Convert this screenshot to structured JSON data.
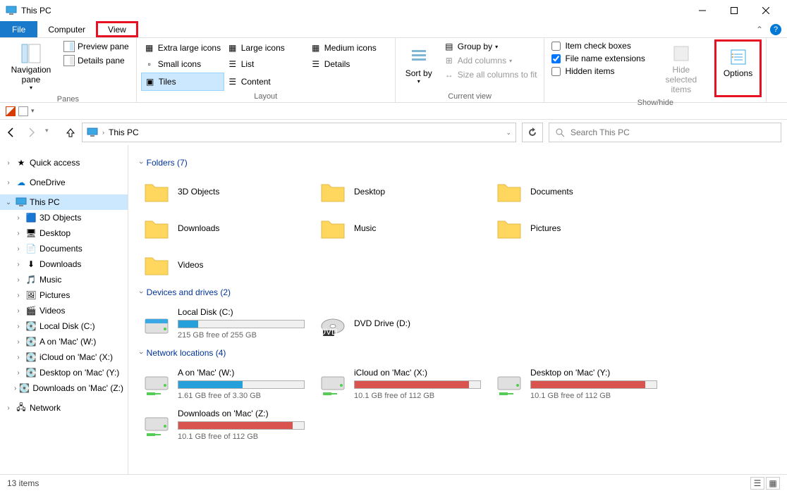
{
  "window": {
    "title": "This PC"
  },
  "tabs": {
    "file": "File",
    "computer": "Computer",
    "view": "View"
  },
  "ribbon": {
    "panes": {
      "navigation": "Navigation pane",
      "preview": "Preview pane",
      "details": "Details pane",
      "group": "Panes"
    },
    "layout": {
      "xl": "Extra large icons",
      "lg": "Large icons",
      "md": "Medium icons",
      "sm": "Small icons",
      "list": "List",
      "det": "Details",
      "tiles": "Tiles",
      "content": "Content",
      "group": "Layout"
    },
    "current": {
      "sort": "Sort by",
      "groupby": "Group by",
      "addcols": "Add columns",
      "sizecols": "Size all columns to fit",
      "group": "Current view"
    },
    "showhide": {
      "itemchk": "Item check boxes",
      "ext": "File name extensions",
      "hidden": "Hidden items",
      "hidesel": "Hide selected items",
      "options": "Options",
      "group": "Show/hide",
      "ext_checked": true,
      "itemchk_checked": false,
      "hidden_checked": false
    }
  },
  "addressbar": {
    "location": "This PC"
  },
  "search": {
    "placeholder": "Search This PC"
  },
  "sidebar": {
    "quick": "Quick access",
    "onedrive": "OneDrive",
    "thispc": "This PC",
    "children": [
      "3D Objects",
      "Desktop",
      "Documents",
      "Downloads",
      "Music",
      "Pictures",
      "Videos",
      "Local Disk (C:)",
      "A on 'Mac' (W:)",
      "iCloud on 'Mac' (X:)",
      "Desktop on 'Mac' (Y:)",
      "Downloads on 'Mac' (Z:)"
    ],
    "network": "Network"
  },
  "sections": {
    "folders": {
      "title": "Folders (7)",
      "items": [
        "3D Objects",
        "Desktop",
        "Documents",
        "Downloads",
        "Music",
        "Pictures",
        "Videos"
      ]
    },
    "drives": {
      "title": "Devices and drives (2)",
      "items": [
        {
          "name": "Local Disk (C:)",
          "sub": "215 GB free of 255 GB",
          "fill": 16,
          "color": "blue",
          "type": "hdd"
        },
        {
          "name": "DVD Drive (D:)",
          "sub": "",
          "fill": 0,
          "color": "",
          "type": "dvd"
        }
      ]
    },
    "network": {
      "title": "Network locations (4)",
      "items": [
        {
          "name": "A on 'Mac' (W:)",
          "sub": "1.61 GB free of 3.30 GB",
          "fill": 51,
          "color": "blue"
        },
        {
          "name": "iCloud on 'Mac' (X:)",
          "sub": "10.1 GB free of 112 GB",
          "fill": 91,
          "color": "red"
        },
        {
          "name": "Desktop on 'Mac' (Y:)",
          "sub": "10.1 GB free of 112 GB",
          "fill": 91,
          "color": "red"
        },
        {
          "name": "Downloads on 'Mac' (Z:)",
          "sub": "10.1 GB free of 112 GB",
          "fill": 91,
          "color": "red"
        }
      ]
    }
  },
  "statusbar": {
    "count": "13 items"
  }
}
